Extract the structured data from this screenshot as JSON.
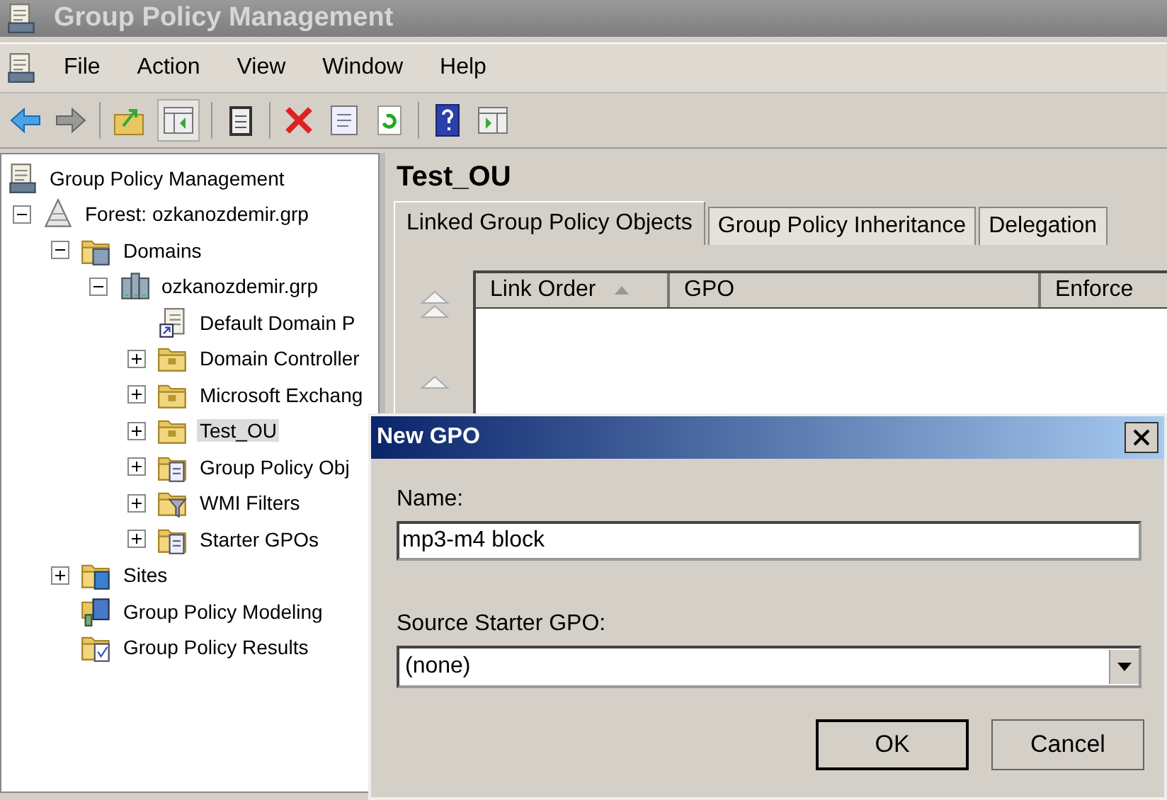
{
  "window": {
    "title": "Group Policy Management"
  },
  "menu": [
    "File",
    "Action",
    "View",
    "Window",
    "Help"
  ],
  "tree": [
    {
      "label": "Group Policy Management",
      "kind": "console",
      "selected": false,
      "children": [
        {
          "label": "Forest: ozkanozdemir.grp",
          "kind": "forest",
          "expanded": true,
          "selected": false,
          "children": [
            {
              "label": "Domains",
              "kind": "domains",
              "expanded": true,
              "selected": false,
              "children": [
                {
                  "label": "ozkanozdemir.grp",
                  "kind": "domain",
                  "expanded": true,
                  "selected": false,
                  "children": [
                    {
                      "label": "Default Domain P",
                      "kind": "link",
                      "selected": false
                    },
                    {
                      "label": "Domain Controller",
                      "kind": "folder",
                      "expanded": false,
                      "selected": false
                    },
                    {
                      "label": "Microsoft Exchang",
                      "kind": "folder",
                      "expanded": false,
                      "selected": false
                    },
                    {
                      "label": "Test_OU",
                      "kind": "folder",
                      "expanded": false,
                      "selected": true
                    },
                    {
                      "label": "Group Policy Obj",
                      "kind": "docfolder",
                      "expanded": false,
                      "selected": false
                    },
                    {
                      "label": "WMI Filters",
                      "kind": "filterfolder",
                      "expanded": false,
                      "selected": false
                    },
                    {
                      "label": "Starter GPOs",
                      "kind": "docfolder",
                      "expanded": false,
                      "selected": false
                    }
                  ]
                }
              ]
            },
            {
              "label": "Sites",
              "kind": "sites",
              "expanded": false,
              "selected": false
            },
            {
              "label": "Group Policy Modeling",
              "kind": "modeling",
              "selected": false
            },
            {
              "label": "Group Policy Results",
              "kind": "results",
              "selected": false
            }
          ]
        }
      ]
    }
  ],
  "panel": {
    "title": "Test_OU",
    "tabs": [
      {
        "label": "Linked Group Policy Objects",
        "selected": true
      },
      {
        "label": "Group Policy Inheritance",
        "selected": false
      },
      {
        "label": "Delegation",
        "selected": false
      }
    ],
    "table": {
      "columns": [
        {
          "label": "Link Order",
          "sorted": true
        },
        {
          "label": "GPO",
          "sorted": false
        },
        {
          "label": "Enforce",
          "sorted": false
        }
      ]
    }
  },
  "dialog": {
    "title": "New GPO",
    "name_label": "Name:",
    "name_value": "mp3-m4 block",
    "source_label": "Source Starter GPO:",
    "source_value": "(none)",
    "buttons": [
      {
        "label": "OK",
        "default": true
      },
      {
        "label": "Cancel",
        "default": false
      }
    ]
  }
}
